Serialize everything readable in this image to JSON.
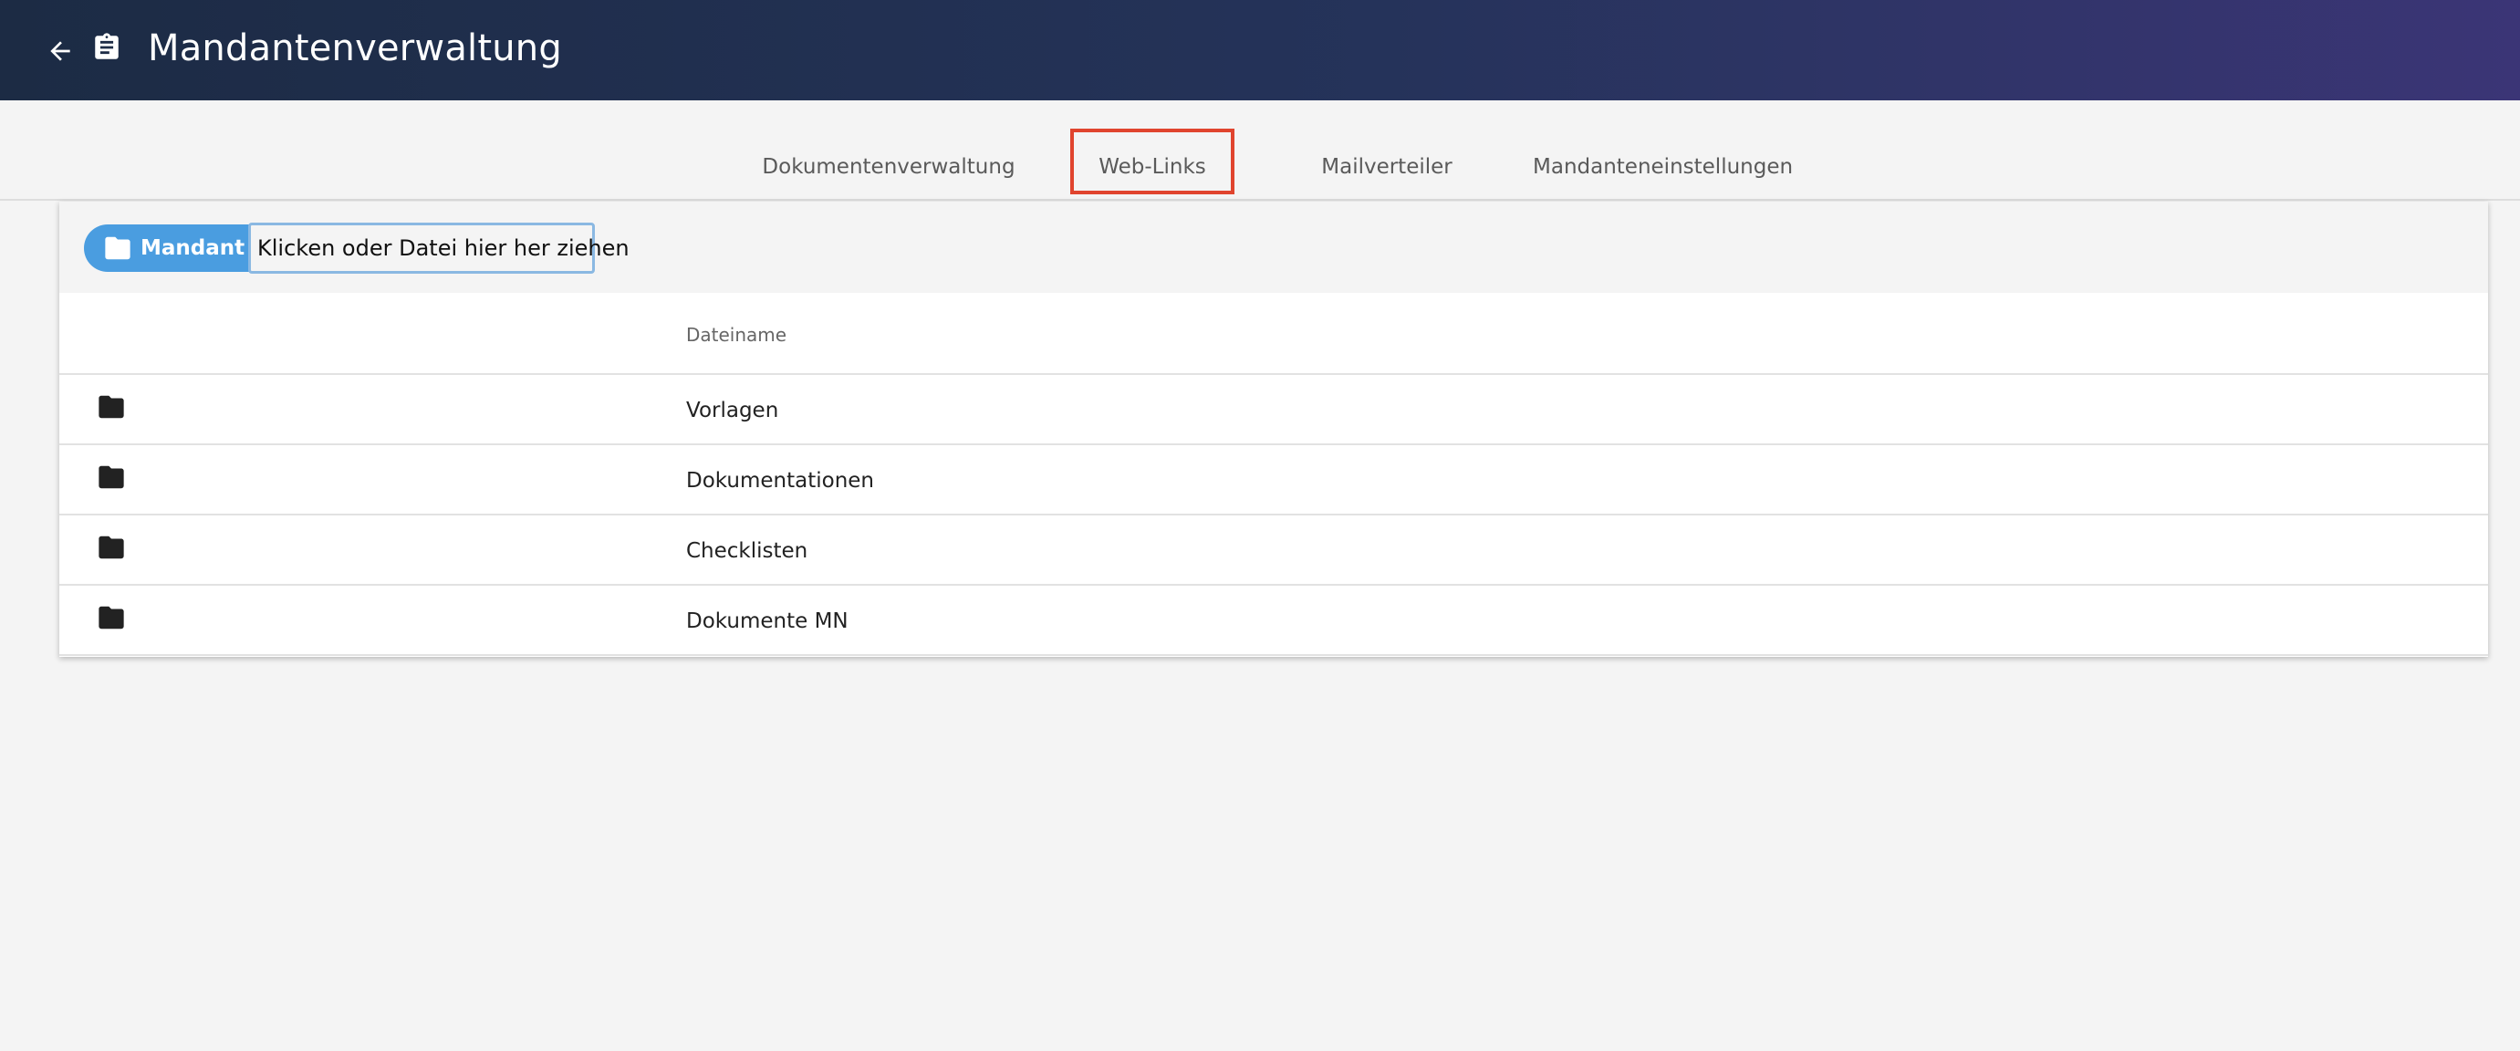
{
  "header": {
    "title": "Mandantenverwaltung",
    "back_icon": "arrow-left-icon",
    "app_icon": "clipboard-icon"
  },
  "tabs": [
    {
      "label": "Dokumentenverwaltung",
      "active": true
    },
    {
      "label": "Web-Links",
      "active": false,
      "highlighted": true
    },
    {
      "label": "Mailverteiler",
      "active": false
    },
    {
      "label": "Mandanteneinstellungen",
      "active": false
    }
  ],
  "toolbar": {
    "mandant_label": "Mandant",
    "upload_text": "Klicken oder Datei hier her ziehen"
  },
  "table": {
    "header_name": "Dateiname",
    "rows": [
      {
        "name": "Vorlagen",
        "icon": "folder-icon"
      },
      {
        "name": "Dokumentationen",
        "icon": "folder-icon"
      },
      {
        "name": "Checklisten",
        "icon": "folder-icon"
      },
      {
        "name": "Dokumente MN",
        "icon": "folder-icon"
      }
    ]
  },
  "colors": {
    "header_start": "#1c2b44",
    "header_end": "#3b3576",
    "accent_blue": "#4a9de0",
    "highlight_red": "#e0442e"
  }
}
